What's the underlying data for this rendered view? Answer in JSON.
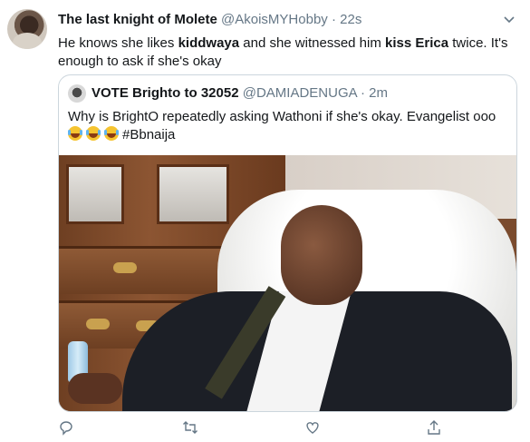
{
  "tweet": {
    "author_name": "The last knight of Molete",
    "author_handle": "@AkoisMYHobby",
    "separator": "·",
    "time": "22s",
    "text_parts": [
      {
        "t": "He knows she likes ",
        "bold": false
      },
      {
        "t": "kiddwaya",
        "bold": true
      },
      {
        "t": " and  she witnessed him ",
        "bold": false
      },
      {
        "t": "kiss Erica",
        "bold": true
      },
      {
        "t": " twice. It's enough to ask if she's okay",
        "bold": false
      }
    ]
  },
  "quoted": {
    "author_name": "VOTE Brighto to 32052",
    "author_handle": "@DAMIADENUGA",
    "separator": "·",
    "time": "2m",
    "text": "Why is BrightO repeatedly asking Wathoni if she's okay. Evangelist ooo",
    "emoji_count": 3,
    "hashtag": "#Bbnaija",
    "image_alt": "photo"
  },
  "icons": {
    "more": "chevron-down-icon",
    "reply": "reply-icon",
    "retweet": "retweet-icon",
    "like": "like-icon",
    "share": "share-icon"
  },
  "colors": {
    "text": "#14171a",
    "secondary": "#657786",
    "border": "#ccd6dd"
  }
}
